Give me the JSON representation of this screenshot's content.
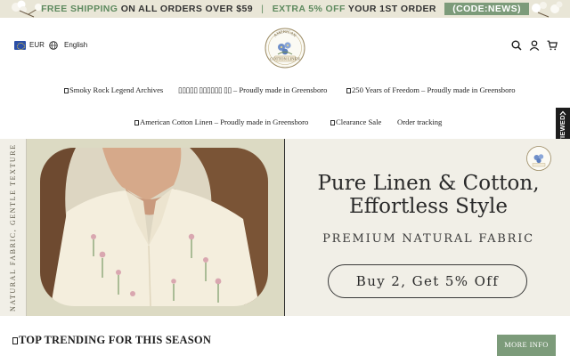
{
  "promo": {
    "part1": "FREE SHIPPING",
    "part2": "ON ALL ORDERS OVER $59",
    "separator": "|",
    "part3": "EXTRA 5% OFF",
    "part4": "YOUR 1ST ORDER",
    "code": "(CODE:NEWS)"
  },
  "header": {
    "currency": "EUR",
    "language": "English",
    "logo_top": "AMERICAN",
    "logo_bottom": "COTTON LINEN",
    "icons": [
      "search-icon",
      "account-icon",
      "cart-icon"
    ]
  },
  "nav": {
    "row1": [
      {
        "label": "Smoky Rock Legend Archives"
      },
      {
        "glyphs": "▯▯▯▯▯ ▯▯▯▯▯▯ ▯▯",
        "label": " – Proudly made in Greensboro"
      },
      {
        "label": "250 Years of Freedom – Proudly made in Greensboro"
      }
    ],
    "row2": [
      {
        "label": "American Cotton Linen – Proudly made in Greensboro"
      },
      {
        "label": "Clearance Sale"
      },
      {
        "label": "Order tracking"
      }
    ]
  },
  "recently_viewed": "RECENTLY VIEWED",
  "hero": {
    "side_caption": "NATURAL FABRIC, GENTLE TEXTURE",
    "title_line1": "Pure Linen & Cotton,",
    "title_line2": "Effortless Style",
    "subtitle": "PREMIUM NATURAL FABRIC",
    "cta": "Buy 2, Get 5% Off"
  },
  "section": {
    "title": "TOP TRENDING FOR THIS SEASON",
    "more_info": "MORE INFO"
  },
  "colors": {
    "promo_bg": "#e9e6d7",
    "accent_green": "#7c9b7a",
    "promo_green": "#5e8a5f",
    "hero_bg": "#f1efe7",
    "photo_panel_bg": "#dcdac3",
    "recent_tab_bg": "#1d1d1d"
  }
}
